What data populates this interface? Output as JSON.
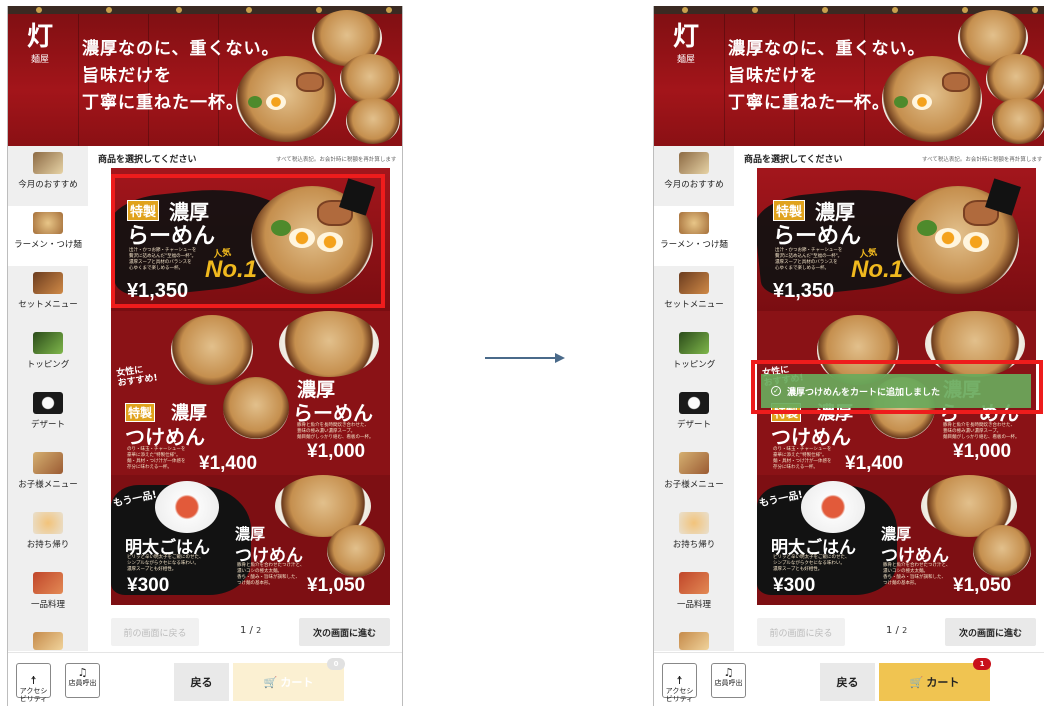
{
  "banner": {
    "logo_main": "灯",
    "logo_sub": "麺屋",
    "tagline": [
      "濃厚なのに、重くない。",
      "旨味だけを",
      "丁寧に重ねた一杯。"
    ]
  },
  "sidebar": {
    "items": [
      {
        "label": "今月のおすすめ"
      },
      {
        "label": "ラーメン・つけ麺"
      },
      {
        "label": "セットメニュー"
      },
      {
        "label": "トッピング"
      },
      {
        "label": "デザート"
      },
      {
        "label": "お子様メニュー"
      },
      {
        "label": "お持ち帰り"
      },
      {
        "label": "一品料理"
      }
    ]
  },
  "content": {
    "heading": "商品を選択してください",
    "note": "すべて税込表記。お会計時に税額を再計算します"
  },
  "menu": {
    "tokusei_tag": "特製",
    "item1": {
      "line1": "濃厚",
      "line2": "らーめん",
      "price": "¥1,350",
      "ninki": "人気",
      "rank": "No.1",
      "desc": "出汁・かつお節・チャーシューを\n贅沢に詰め込んだ\"至福の一杯\"。\n濃厚スープと具材のバランスを\n心ゆくまで楽しめる一杯。"
    },
    "item2": {
      "pre": "女性に\nおすすめ!",
      "tag": "特製",
      "line1": "濃厚",
      "line2": "つけめん",
      "price": "¥1,400",
      "desc": "のり・味玉・チャーシューを\n豪華に添えた\"特製仕様\"。\n麺・具材・つけ汁が一体感を\n存分に味わえる一杯。"
    },
    "item3": {
      "line1": "濃厚",
      "line2": "らーめん",
      "price": "¥1,000",
      "desc": "豚骨と魚介を長時間炊き合わせた、\n豊味の極み濃い濃厚スープ。\n麺目麺がしっかり絡む、看板の一杯。"
    },
    "item4": {
      "pre": "もう一品!",
      "line1": "明太ごはん",
      "price": "¥300",
      "desc": "ピリッと辛い明太子をご飯にのせた、\nシンプルながらクセになる味わい。\n濃厚スープとも好相性。"
    },
    "item5": {
      "line1": "濃厚",
      "line2": "つけめん",
      "price": "¥1,050",
      "desc": "豚骨と魚介を合わせたつけ汁と、\n濃いコシの極太太麺。\n香ち・酸み・旨味が調和した、\nつけ麺の基本形。"
    }
  },
  "pager": {
    "prev": "前の画面に戻る",
    "current": "1",
    "total": "2",
    "next": "次の画面に進む"
  },
  "bottom": {
    "accessibility": "アクセシ\nビリティ",
    "staff": "店員呼出",
    "back": "戻る",
    "cart": "カート",
    "cart_icon": "🛒",
    "badge_before": "0",
    "badge_after": "1"
  },
  "toast": "濃厚つけめんをカートに追加しました",
  "colors": {
    "highlight": "#ee1c1c",
    "cart_active": "#f0c451",
    "badge_active": "#c8101a",
    "toast": "#69aa5c"
  }
}
